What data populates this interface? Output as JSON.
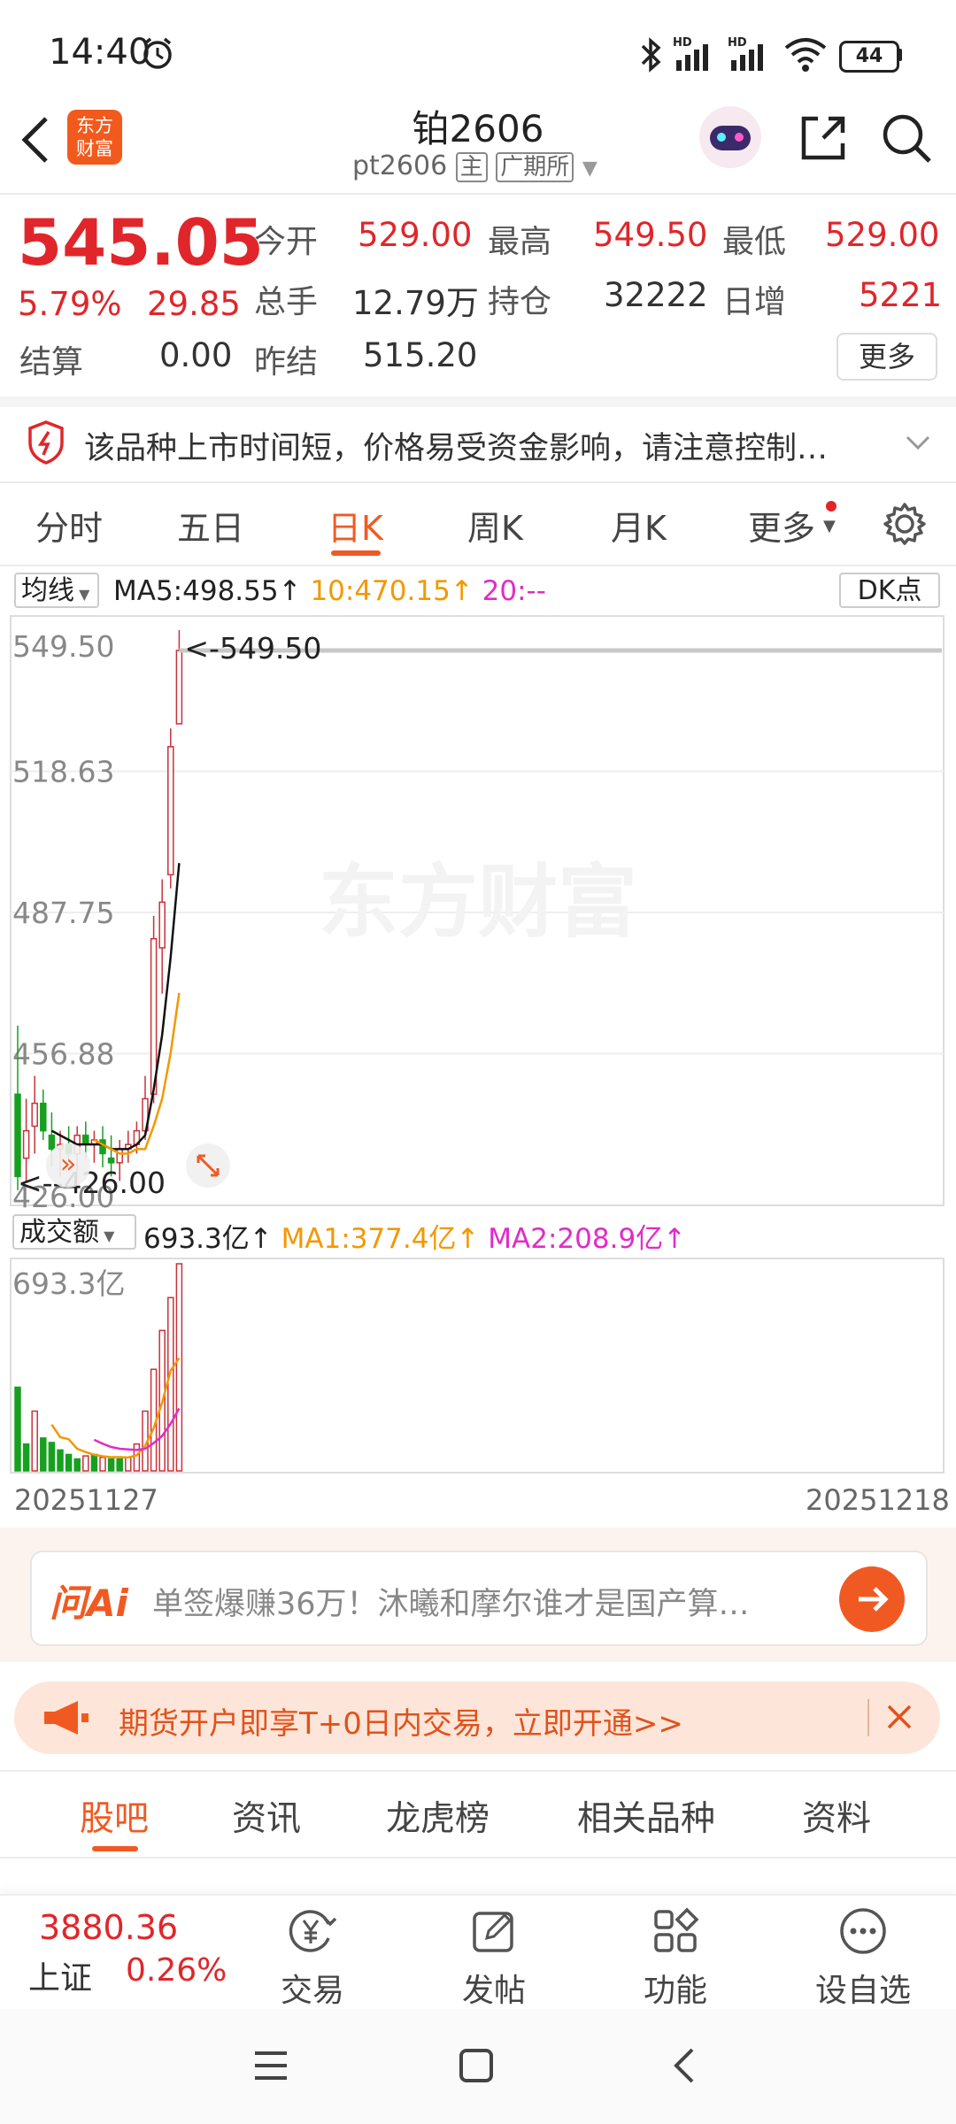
{
  "status_bar": {
    "time": "14:40",
    "battery": "44",
    "icons": [
      "alarm-icon",
      "bluetooth-icon",
      "signal-hd-icon",
      "signal-hd-icon",
      "wifi-icon",
      "battery-icon"
    ]
  },
  "header": {
    "title": "铂2606",
    "code": "pt2606",
    "badge_main": "主",
    "exchange": "广期所",
    "app_logo": "东方财富"
  },
  "quote": {
    "price": "545.05",
    "change_pct": "5.79%",
    "change": "29.85",
    "open_label": "今开",
    "open": "529.00",
    "high_label": "最高",
    "high": "549.50",
    "low_label": "最低",
    "low": "529.00",
    "volume_label": "总手",
    "volume": "12.79万",
    "oi_label": "持仓",
    "oi": "32222",
    "daily_inc_label": "日增",
    "daily_inc": "5221",
    "settle_label": "结算",
    "settle": "0.00",
    "prev_settle_label": "昨结",
    "prev_settle": "515.20",
    "more_label": "更多"
  },
  "notice": {
    "text": "该品种上市时间短，价格易受资金影响，请注意控制…"
  },
  "period_tabs": [
    "分时",
    "五日",
    "日K",
    "周K",
    "月K",
    "更多"
  ],
  "active_tab": "日K",
  "ma_legend": {
    "type": "均线",
    "ma5": "MA5:498.55↑",
    "ma10": "10:470.15↑",
    "ma20": "20:--",
    "dk": "DK点"
  },
  "chart_data": [
    {
      "type": "candlestick",
      "ylim": [
        426.0,
        549.5
      ],
      "y_ticks": [
        "549.50",
        "518.63",
        "487.75",
        "456.88",
        "426.00"
      ],
      "max_annotation": "<-549.50",
      "min_annotation": "<--426.00",
      "watermark": "东方财富",
      "candles": [
        {
          "o": 448,
          "h": 463,
          "l": 427,
          "c": 430,
          "dir": "down"
        },
        {
          "o": 434,
          "h": 447,
          "l": 429,
          "c": 440,
          "dir": "up"
        },
        {
          "o": 441,
          "h": 452,
          "l": 435,
          "c": 446,
          "dir": "up"
        },
        {
          "o": 446,
          "h": 449,
          "l": 438,
          "c": 440,
          "dir": "down"
        },
        {
          "o": 439,
          "h": 444,
          "l": 432,
          "c": 436,
          "dir": "down"
        },
        {
          "o": 436,
          "h": 440,
          "l": 430,
          "c": 437,
          "dir": "up"
        },
        {
          "o": 437,
          "h": 441,
          "l": 434,
          "c": 435,
          "dir": "down"
        },
        {
          "o": 435,
          "h": 441,
          "l": 431,
          "c": 439,
          "dir": "up"
        },
        {
          "o": 439,
          "h": 442,
          "l": 434,
          "c": 437,
          "dir": "down"
        },
        {
          "o": 437,
          "h": 440,
          "l": 433,
          "c": 438,
          "dir": "up"
        },
        {
          "o": 438,
          "h": 441,
          "l": 432,
          "c": 435,
          "dir": "down"
        },
        {
          "o": 434,
          "h": 439,
          "l": 430,
          "c": 433,
          "dir": "down"
        },
        {
          "o": 433,
          "h": 438,
          "l": 429,
          "c": 436,
          "dir": "up"
        },
        {
          "o": 436,
          "h": 440,
          "l": 433,
          "c": 437,
          "dir": "up"
        },
        {
          "o": 437,
          "h": 442,
          "l": 435,
          "c": 440,
          "dir": "up"
        },
        {
          "o": 440,
          "h": 452,
          "l": 438,
          "c": 447,
          "dir": "up"
        },
        {
          "o": 448,
          "h": 487,
          "l": 446,
          "c": 482,
          "dir": "up"
        },
        {
          "o": 480,
          "h": 495,
          "l": 470,
          "c": 490,
          "dir": "up"
        },
        {
          "o": 496,
          "h": 528,
          "l": 493,
          "c": 524,
          "dir": "up"
        },
        {
          "o": 529,
          "h": 549.5,
          "l": 529,
          "c": 545.05,
          "dir": "up"
        }
      ],
      "ma_lines": [
        {
          "name": "MA5",
          "color": "#111111",
          "values": [
            null,
            null,
            null,
            null,
            440,
            439,
            438,
            437,
            437,
            437,
            437,
            436,
            436,
            436,
            437,
            439,
            449,
            461,
            478,
            498.55
          ]
        },
        {
          "name": "MA10",
          "color": "#f39800",
          "values": [
            null,
            null,
            null,
            null,
            null,
            null,
            null,
            null,
            null,
            438,
            437,
            436,
            435,
            435,
            436,
            436,
            441,
            447,
            457,
            470.15
          ]
        }
      ]
    },
    {
      "type": "bar",
      "indicator": "成交额",
      "value_label": "693.3亿↑",
      "ma1_label": "MA1:377.4亿↑",
      "ma2_label": "MA2:208.9亿↑",
      "y_top_label": "693.3亿",
      "x_start": "20251127",
      "x_end": "20251218",
      "values": [
        280,
        90,
        200,
        110,
        95,
        70,
        55,
        40,
        50,
        55,
        45,
        40,
        40,
        45,
        90,
        200,
        340,
        470,
        580,
        693.3
      ],
      "dirs": [
        "down",
        "down",
        "up",
        "down",
        "down",
        "down",
        "down",
        "down",
        "up",
        "down",
        "up",
        "down",
        "down",
        "up",
        "up",
        "up",
        "up",
        "up",
        "up",
        "up"
      ],
      "ma_lines": [
        {
          "name": "MA1",
          "color": "#f39800",
          "values": [
            null,
            null,
            null,
            null,
            155,
            113,
            106,
            74,
            63,
            54,
            49,
            46,
            46,
            45,
            52,
            84,
            143,
            229,
            336,
            377.4
          ]
        },
        {
          "name": "MA2",
          "color": "#e02cc8",
          "values": [
            null,
            null,
            null,
            null,
            null,
            null,
            null,
            null,
            null,
            104,
            91,
            80,
            74,
            72,
            70,
            74,
            93,
            117,
            158,
            208.9
          ]
        }
      ]
    }
  ],
  "ai_bar": {
    "logo": "问Ai",
    "text": "单签爆赚36万！沐曦和摩尔谁才是国产算…"
  },
  "promo": {
    "text": "期货开户即享T+0日内交易，立即开通>>"
  },
  "section_tabs": [
    "股吧",
    "资讯",
    "龙虎榜",
    "相关品种",
    "资料"
  ],
  "active_section": "股吧",
  "bottom_bar": {
    "index_value": "3880.36",
    "index_name": "上证",
    "index_change": "0.26%",
    "items": [
      "交易",
      "发帖",
      "功能",
      "设自选"
    ]
  }
}
